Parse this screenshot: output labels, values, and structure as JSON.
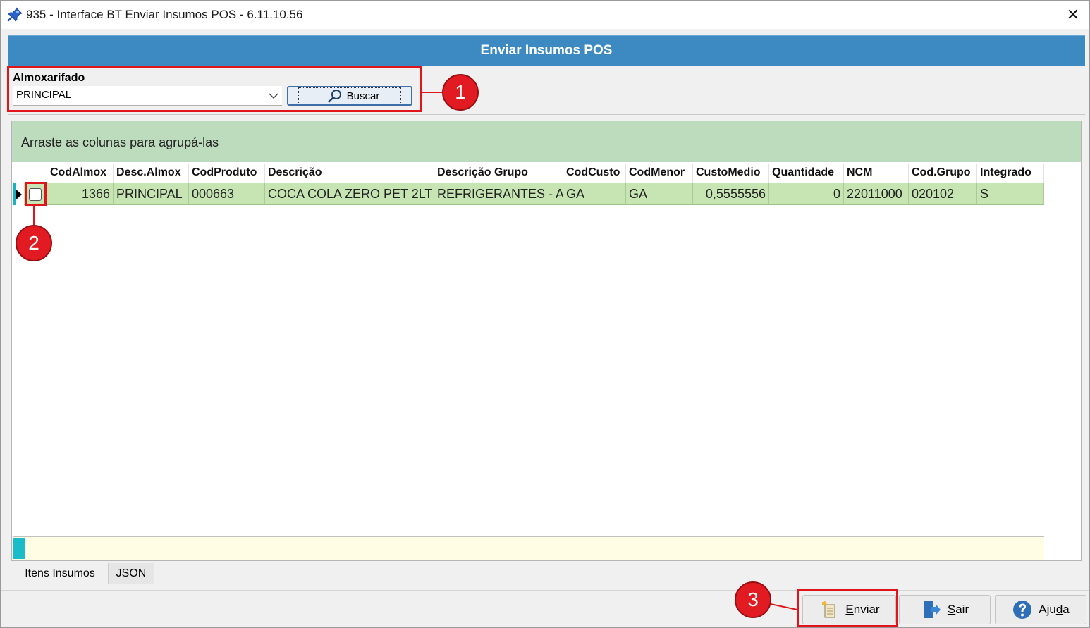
{
  "window": {
    "title": "935 - Interface BT Enviar Insumos POS - 6.11.10.56",
    "close_glyph": "✕"
  },
  "header": {
    "title": "Enviar Insumos POS"
  },
  "filter": {
    "label": "Almoxarifado",
    "selected_value": "PRINCIPAL",
    "search_button_label": "Buscar"
  },
  "grid": {
    "group_hint": "Arraste as colunas para agrupá-las",
    "columns": [
      "CodAlmox",
      "Desc.Almox",
      "CodProduto",
      "Descrição",
      "Descrição Grupo",
      "CodCusto",
      "CodMenor",
      "CustoMedio",
      "Quantidade",
      "NCM",
      "Cod.Grupo",
      "Integrado"
    ],
    "rows": [
      {
        "checked": false,
        "cells": [
          "1366",
          "PRINCIPAL",
          "000663",
          "COCA COLA ZERO PET 2LT",
          "REFRIGERANTES - A",
          "GA",
          "GA",
          "0,5555556",
          "0",
          "22011000",
          "020102",
          "S"
        ]
      }
    ]
  },
  "tabs": [
    {
      "label": "Itens Insumos",
      "active": true
    },
    {
      "label": "JSON",
      "active": false
    }
  ],
  "actions": {
    "send": {
      "underline": "E",
      "rest": "nviar"
    },
    "exit": {
      "underline": "S",
      "rest": "air"
    },
    "help": {
      "prefix": "Aju",
      "underline": "d",
      "rest": "a"
    }
  },
  "callouts": [
    "1",
    "2",
    "3"
  ],
  "colors": {
    "header_blue": "#3d8ac2",
    "group_panel_green": "#bddcbd",
    "selected_row_green": "#c6e5b3",
    "highlight_red": "#e0151c"
  }
}
